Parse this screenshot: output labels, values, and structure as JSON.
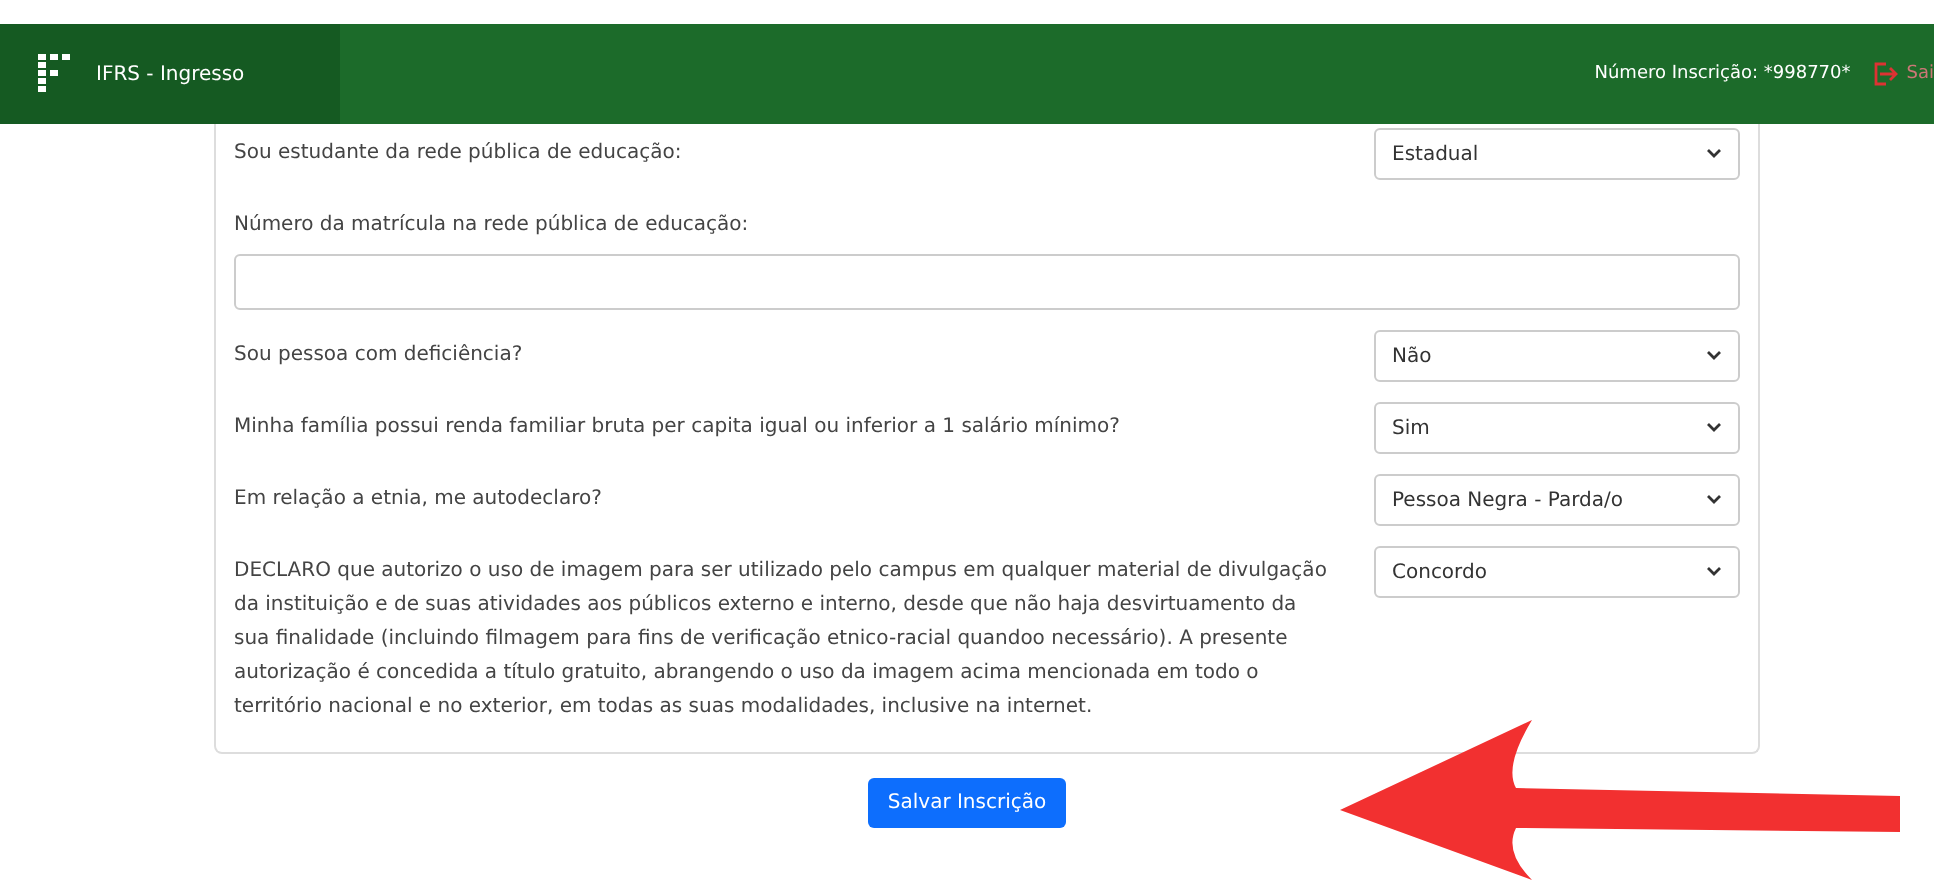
{
  "header": {
    "title": "IFRS - Ingresso",
    "registration": "Número Inscrição: *998770*",
    "logout": "Sai"
  },
  "form": {
    "rows": [
      {
        "kind": "select",
        "label": "Sou estudante da rede pública de educação:",
        "value": "Estadual"
      },
      {
        "kind": "input",
        "label": "Número da matrícula na rede pública de educação:"
      },
      {
        "kind": "select",
        "label": "Sou pessoa com deficiência?",
        "value": "Não"
      },
      {
        "kind": "select",
        "label": "Minha família possui renda familiar bruta per capita igual ou inferior a 1 salário mínimo?",
        "value": "Sim"
      },
      {
        "kind": "select",
        "label": "Em relação a etnia, me autodeclaro?",
        "value": "Pessoa Negra - Parda/o"
      },
      {
        "kind": "select",
        "label": "DECLARO que autorizo o uso de imagem para ser utilizado pelo campus em qualquer material de divulgação da instituição e de suas atividades aos públicos externo e interno, desde que não haja desvirtuamento da sua finalidade (incluindo filmagem para fins de verificação etnico-racial quandoo necessário). A presente autorização é concedida a título gratuito, abrangendo o uso da imagem acima mencionada em todo o território nacional e no exterior, em todas as suas modalidades, inclusive na internet.",
        "value": "Concordo"
      }
    ]
  },
  "submit": "Salvar Inscrição"
}
